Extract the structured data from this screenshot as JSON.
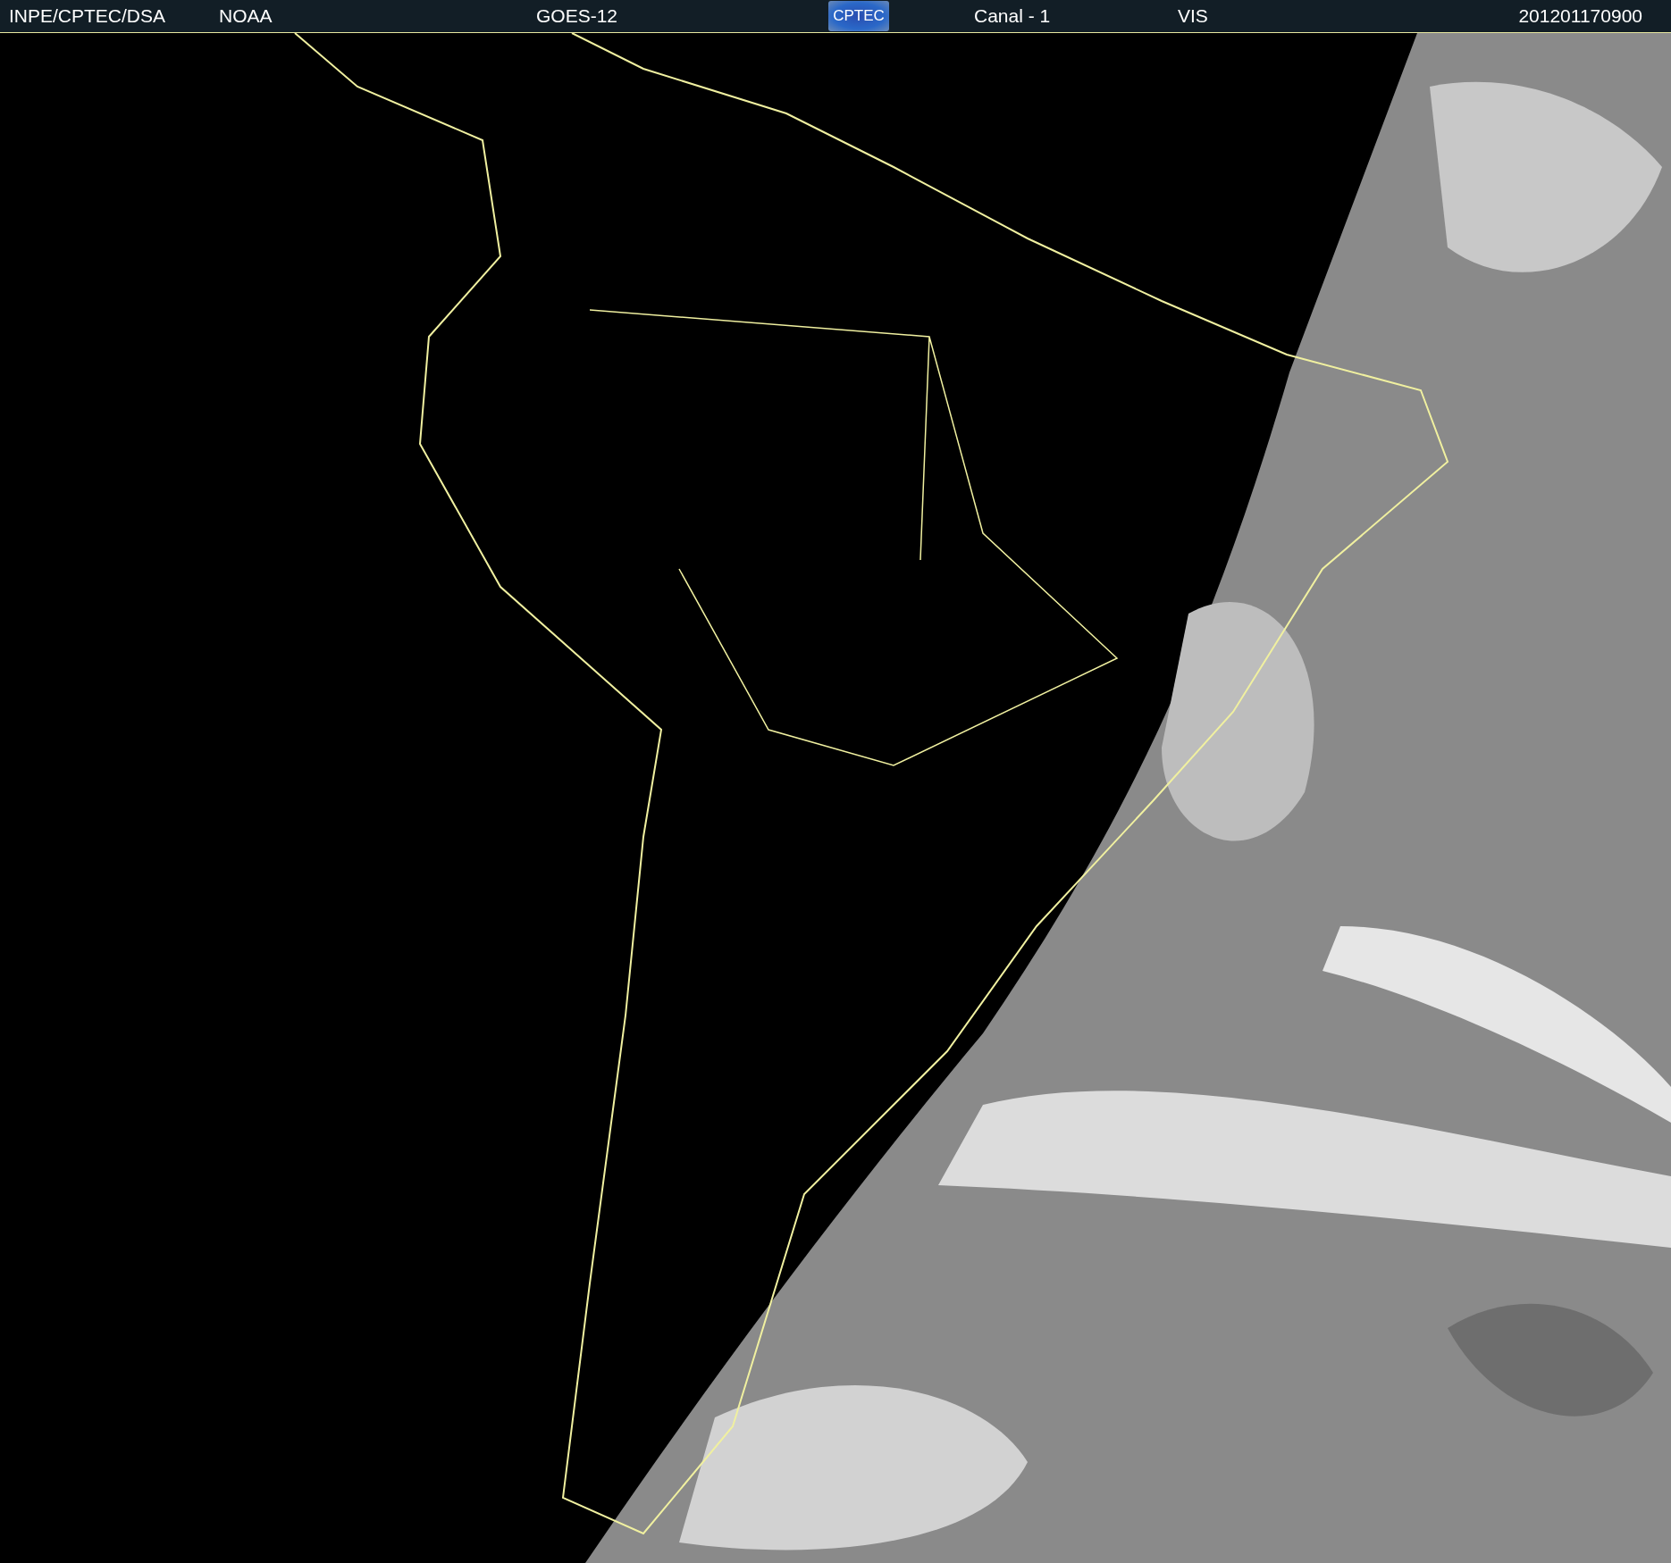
{
  "header": {
    "source": "INPE/CPTEC/DSA",
    "agency": "NOAA",
    "satellite": "GOES-12",
    "logo_text": "CPTEC",
    "channel": "Canal - 1",
    "band": "VIS",
    "timestamp": "201201170900"
  }
}
